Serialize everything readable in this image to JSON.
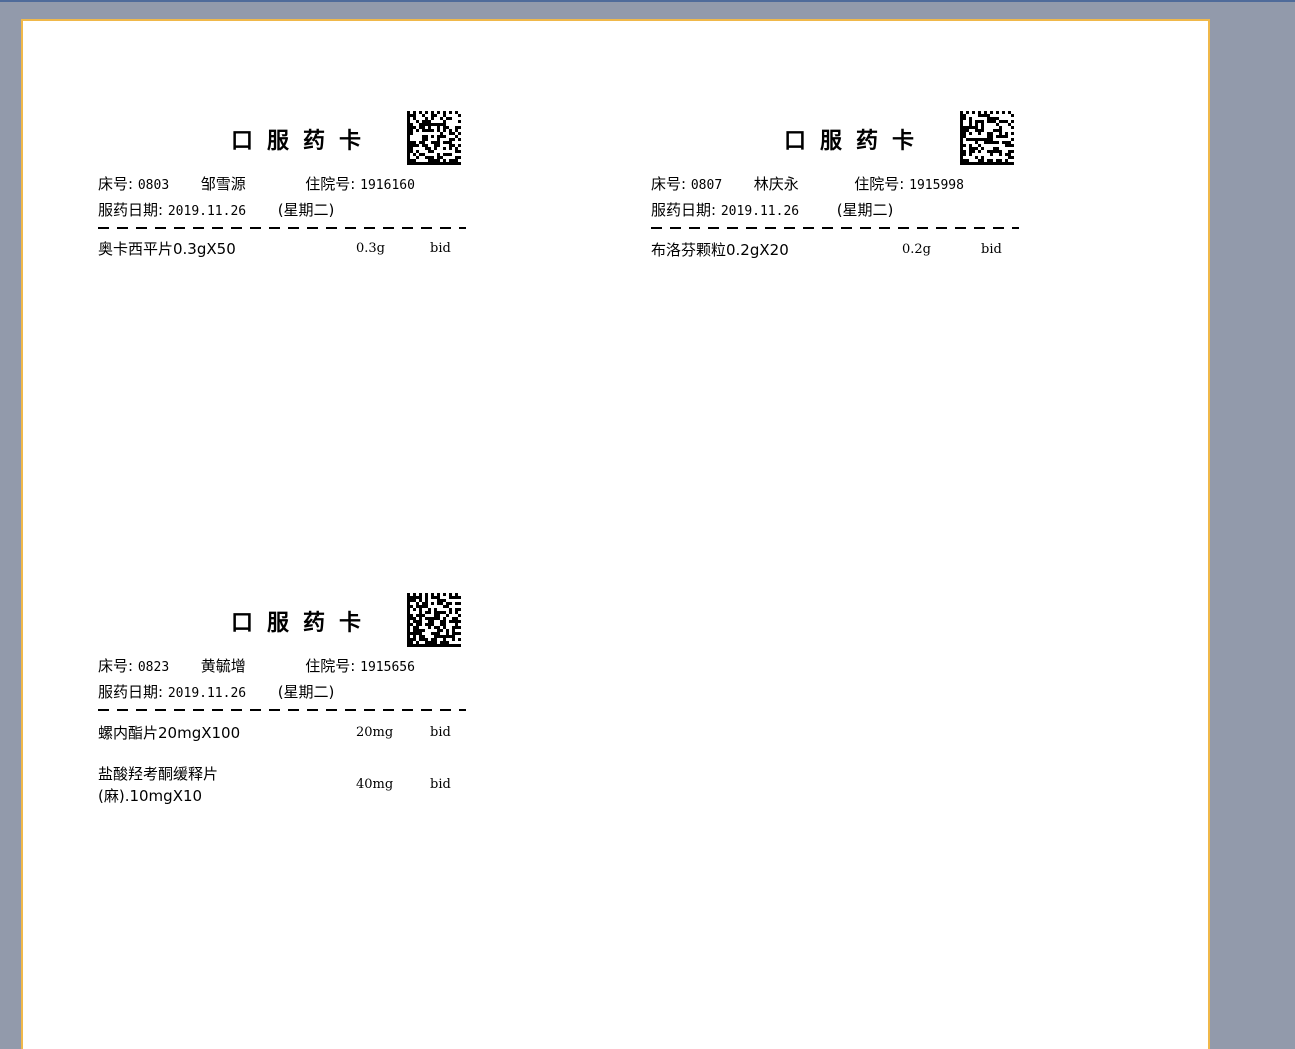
{
  "cards": [
    {
      "title": "口服药卡",
      "bed_label": "床号:",
      "bed": "0803",
      "patient": "邹雪源",
      "hosp_label": "住院号:",
      "hosp_no": "1916160",
      "date_label": "服药日期:",
      "date": "2019.11.26",
      "weekday": "(星期二)",
      "meds": [
        {
          "name": "奥卡西平片0.3gX50",
          "dose": "0.3g",
          "freq": "bid"
        }
      ]
    },
    {
      "title": "口服药卡",
      "bed_label": "床号:",
      "bed": "0807",
      "patient": "林庆永",
      "hosp_label": "住院号:",
      "hosp_no": "1915998",
      "date_label": "服药日期:",
      "date": "2019.11.26",
      "weekday": "(星期二)",
      "meds": [
        {
          "name": "布洛芬颗粒0.2gX20",
          "dose": "0.2g",
          "freq": "bid"
        }
      ]
    },
    {
      "title": "口服药卡",
      "bed_label": "床号:",
      "bed": "0823",
      "patient": "黄毓增",
      "hosp_label": "住院号:",
      "hosp_no": "1915656",
      "date_label": "服药日期:",
      "date": "2019.11.26",
      "weekday": "(星期二)",
      "meds": [
        {
          "name": "螺内酯片20mgX100",
          "dose": "20mg",
          "freq": "bid"
        },
        {
          "name_line1": "盐酸羟考酮缓释片",
          "name_line2": "(麻).10mgX10",
          "dose": "40mg",
          "freq": "bid"
        }
      ]
    }
  ]
}
